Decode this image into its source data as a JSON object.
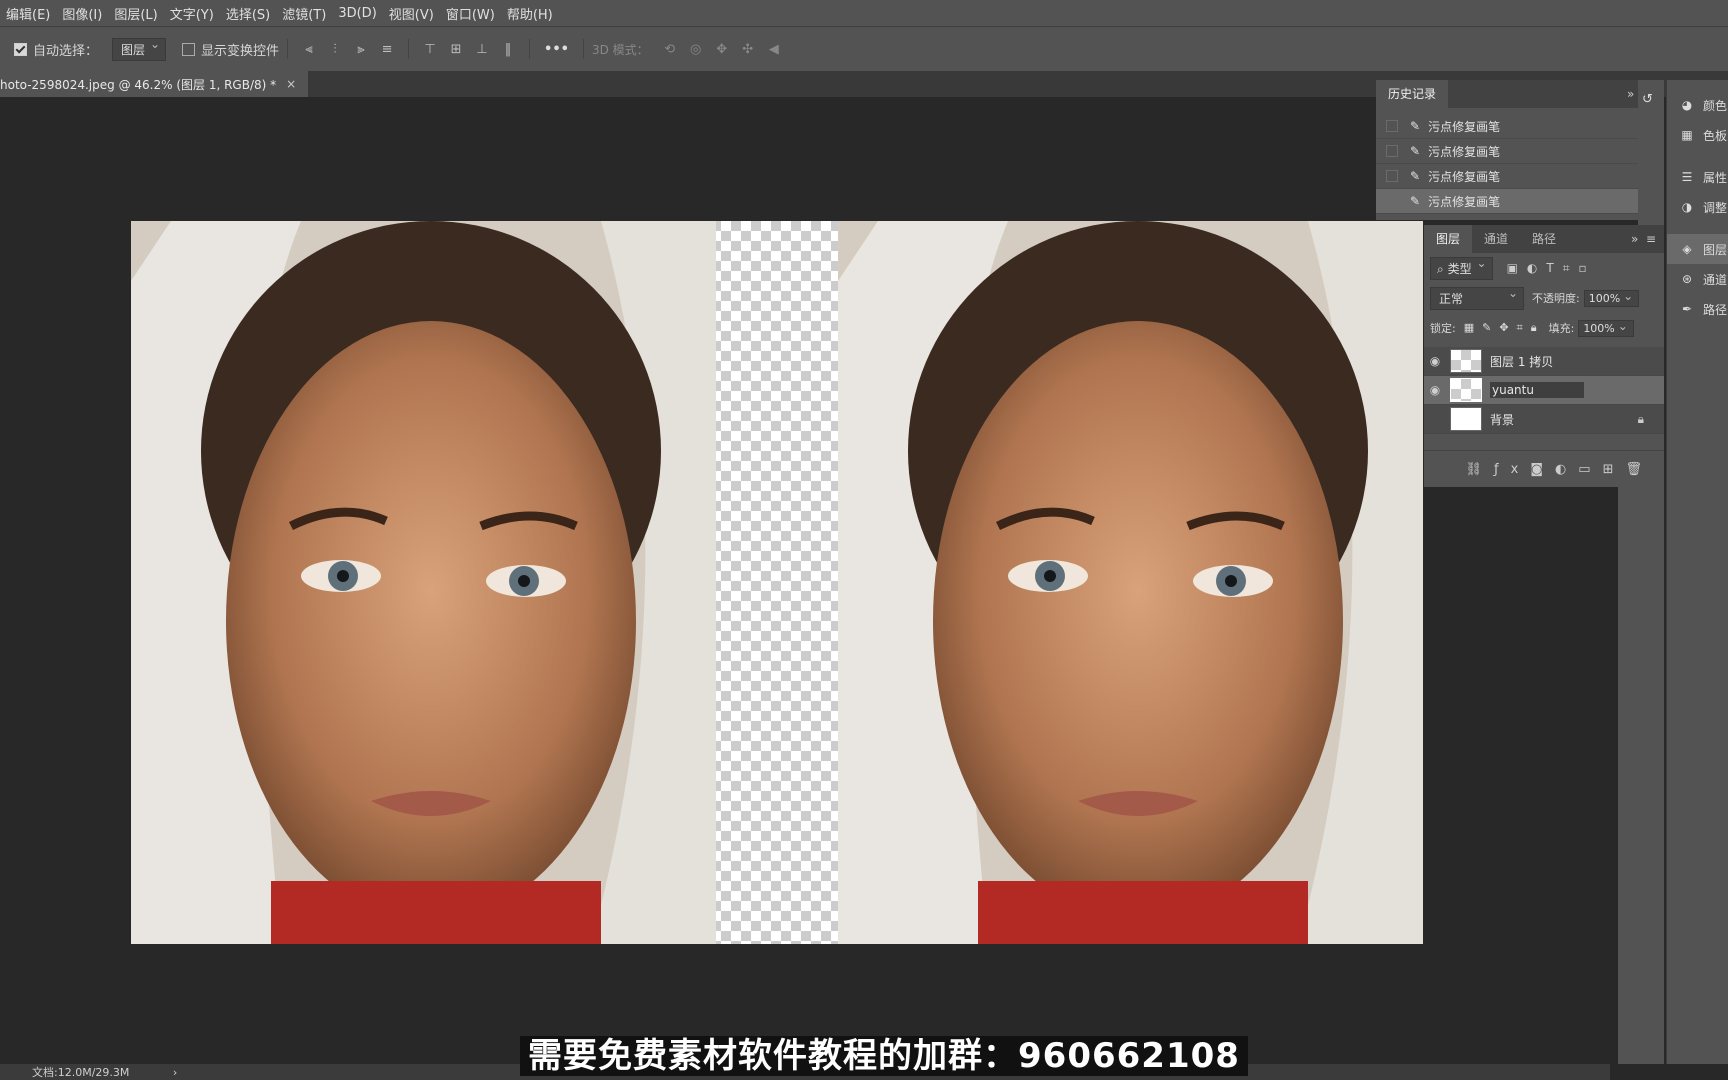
{
  "menu": [
    "编辑(E)",
    "图像(I)",
    "图层(L)",
    "文字(Y)",
    "选择(S)",
    "滤镜(T)",
    "3D(D)",
    "视图(V)",
    "窗口(W)",
    "帮助(H)"
  ],
  "options": {
    "auto_select_label": "自动选择：",
    "auto_select_value": "图层",
    "show_transform_label": "显示变换控件",
    "more_label": "•••",
    "mode_3d_label": "3D 模式："
  },
  "document_tab": {
    "title": "hoto-2598024.jpeg @ 46.2% (图层 1, RGB/8) *",
    "close": "×"
  },
  "history": {
    "title": "历史记录",
    "items": [
      "污点修复画笔",
      "污点修复画笔",
      "污点修复画笔",
      "污点修复画笔"
    ]
  },
  "layers_panel": {
    "tabs": [
      "图层",
      "通道",
      "路径"
    ],
    "filter_label": "类型",
    "blend_mode": "正常",
    "opacity_label": "不透明度:",
    "opacity_value": "100%",
    "lock_label": "锁定:",
    "fill_label": "填充:",
    "fill_value": "100%",
    "layers": [
      {
        "name": "图层 1 拷贝",
        "visible": true,
        "locked": false
      },
      {
        "name": "yuantu",
        "visible": true,
        "locked": false
      },
      {
        "name": "背景",
        "visible": false,
        "locked": true
      }
    ]
  },
  "dock": [
    "颜色",
    "色板",
    "属性",
    "调整",
    "图层",
    "通道",
    "路径"
  ],
  "status": {
    "doc_size": "文档:12.0M/29.3M",
    "arrow": "›"
  },
  "subtitle": "需要免费素材软件教程的加群：960662108"
}
